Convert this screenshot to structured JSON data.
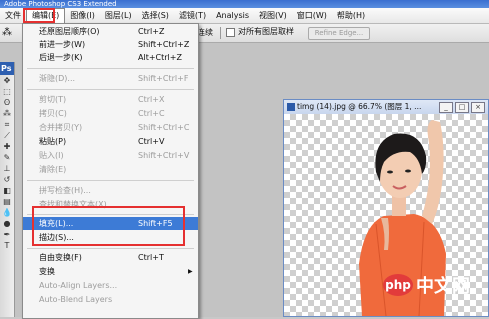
{
  "app": {
    "title": "Adobe Photoshop CS3 Extended"
  },
  "menubar": {
    "items": [
      "文件",
      "编辑(E)",
      "图像(I)",
      "图层(L)",
      "选择(S)",
      "滤镜(T)",
      "Analysis",
      "视图(V)",
      "窗口(W)",
      "帮助(H)"
    ]
  },
  "options_bar": {
    "tool_icon": "magic-wand-icon",
    "continuous_label": "连续",
    "sample_all_label": "对所有图层取样",
    "refine_edge_label": "Refine Edge..."
  },
  "toolbox": {
    "header": "Ps"
  },
  "document": {
    "title": "timg (14).jpg @ 66.7% (图层 1, ...",
    "controls": [
      "_",
      "□",
      "×"
    ]
  },
  "edit_menu": {
    "items": [
      {
        "label": "还原图层顺序(O)",
        "shortcut": "Ctrl+Z",
        "disabled": false
      },
      {
        "label": "前进一步(W)",
        "shortcut": "Shift+Ctrl+Z",
        "disabled": false
      },
      {
        "label": "后退一步(K)",
        "shortcut": "Alt+Ctrl+Z",
        "disabled": false
      },
      {
        "label": "渐隐(D)...",
        "shortcut": "Shift+Ctrl+F",
        "disabled": true
      },
      {
        "label": "剪切(T)",
        "shortcut": "Ctrl+X",
        "disabled": true
      },
      {
        "label": "拷贝(C)",
        "shortcut": "Ctrl+C",
        "disabled": true
      },
      {
        "label": "合并拷贝(Y)",
        "shortcut": "Shift+Ctrl+C",
        "disabled": true
      },
      {
        "label": "粘贴(P)",
        "shortcut": "Ctrl+V",
        "disabled": false
      },
      {
        "label": "贴入(I)",
        "shortcut": "Shift+Ctrl+V",
        "disabled": true
      },
      {
        "label": "清除(E)",
        "shortcut": "",
        "disabled": true
      },
      {
        "label": "拼写检查(H)...",
        "shortcut": "",
        "disabled": true
      },
      {
        "label": "查找和替换文本(X)...",
        "shortcut": "",
        "disabled": true
      },
      {
        "label": "填充(L)...",
        "shortcut": "Shift+F5",
        "disabled": false,
        "highlighted": true
      },
      {
        "label": "描边(S)...",
        "shortcut": "",
        "disabled": false
      },
      {
        "label": "自由变换(F)",
        "shortcut": "Ctrl+T",
        "disabled": false
      },
      {
        "label": "变换",
        "shortcut": "",
        "disabled": false,
        "submenu": true
      },
      {
        "label": "Auto-Align Layers...",
        "shortcut": "",
        "disabled": true
      },
      {
        "label": "Auto-Blend Layers",
        "shortcut": "",
        "disabled": true
      }
    ]
  },
  "watermark": {
    "badge": "php",
    "text": "中文网"
  },
  "colors": {
    "highlight": "#3d7bd6",
    "annotation_red": "#e53030",
    "dress_orange": "#f06a3c"
  }
}
